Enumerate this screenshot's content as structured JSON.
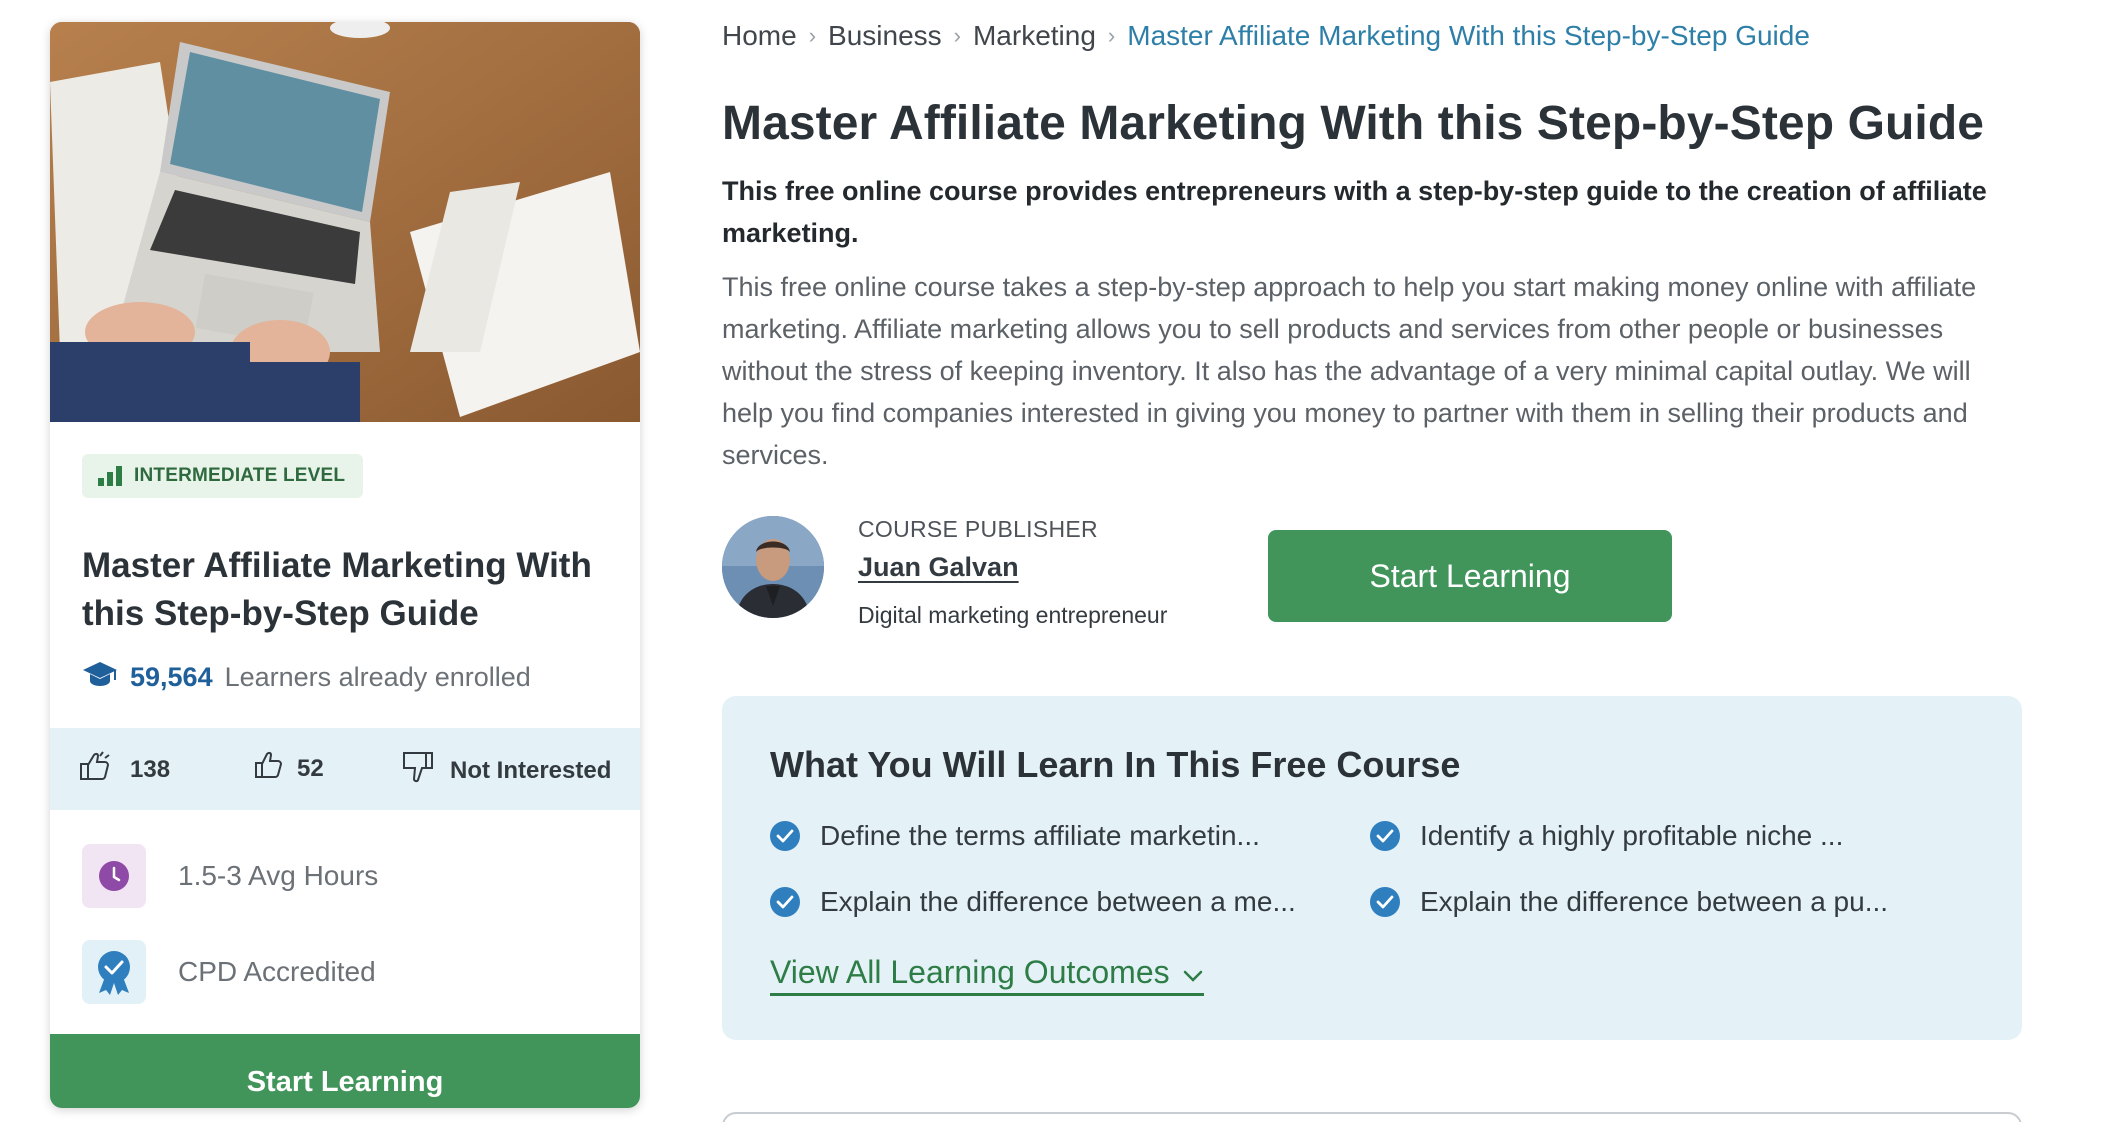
{
  "course_card": {
    "level_label": "INTERMEDIATE LEVEL",
    "title": "Master Affiliate Marketing With this Step-by-Step Guide",
    "enrolled_count": "59,564",
    "enrolled_text": "Learners already enrolled",
    "reactions": {
      "likes": "138",
      "thumbs_up": "52",
      "not_interested": "Not Interested"
    },
    "duration": "1.5-3 Avg Hours",
    "accreditation": "CPD Accredited",
    "cta_label": "Start Learning"
  },
  "breadcrumb": {
    "items": [
      "Home",
      "Business",
      "Marketing"
    ],
    "current": "Master Affiliate Marketing With this Step-by-Step Guide"
  },
  "main": {
    "title": "Master Affiliate Marketing With this Step-by-Step Guide",
    "subtitle": "This free online course provides entrepreneurs with a step-by-step guide to the creation of affiliate marketing.",
    "description": "This free online course takes a step-by-step approach to help you start making money online with affiliate marketing. Affiliate marketing allows you to sell products and services from other people or businesses without the stress of keeping inventory. It also has the advantage of a very minimal capital outlay. We will help you find companies interested in giving you money to partner with them in selling their products and services.",
    "publisher": {
      "role_label": "COURSE PUBLISHER",
      "name": "Juan Galvan",
      "bio": "Digital marketing entrepreneur"
    },
    "cta_label": "Start Learning"
  },
  "learning": {
    "title": "What You Will Learn In This Free Course",
    "outcomes": [
      "Define the terms affiliate marketin...",
      "Identify a highly profitable niche ...",
      "Explain the difference between a me...",
      "Explain the difference between a pu..."
    ],
    "view_all_label": "View All Learning Outcomes"
  },
  "colors": {
    "primary_green": "#41955a",
    "link_blue": "#2e7fa8",
    "light_blue_bg": "#e4f1f7",
    "check_blue": "#2f7fbf"
  }
}
